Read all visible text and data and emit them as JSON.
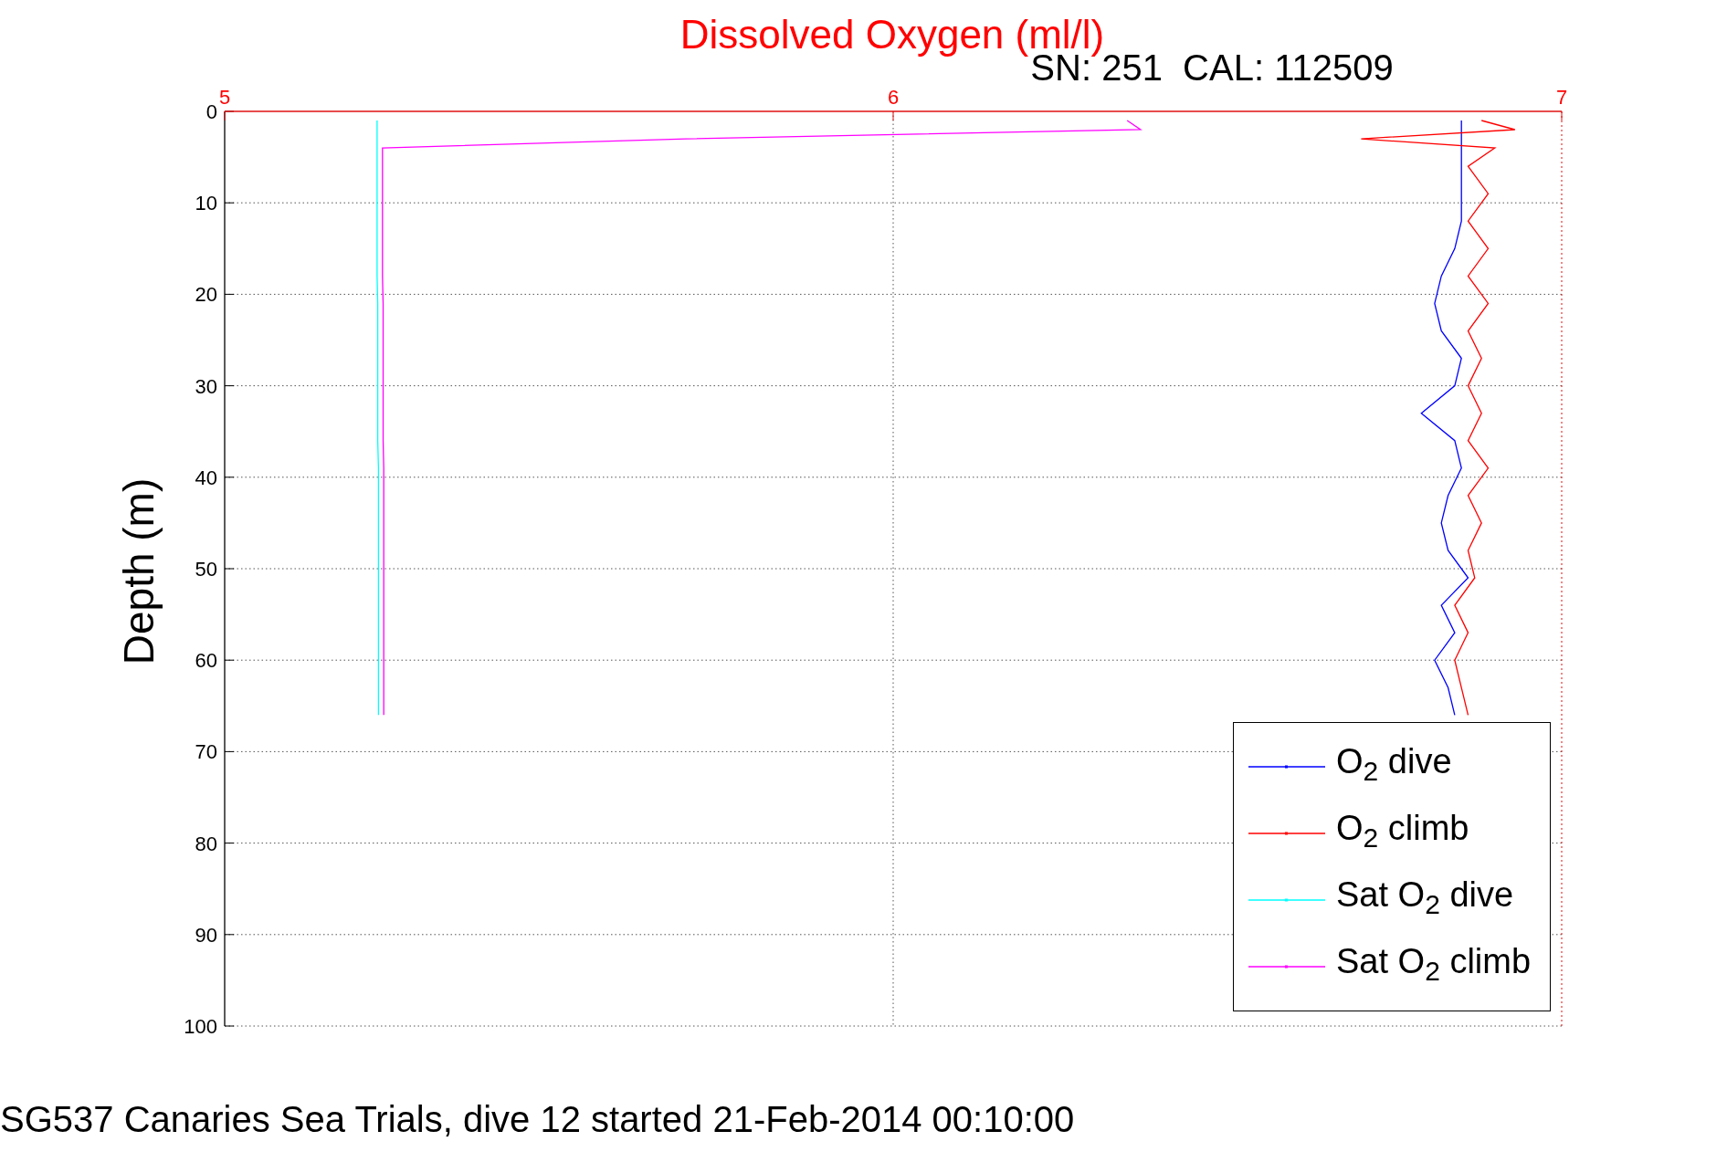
{
  "chart": {
    "chart_data": {
      "type": "line",
      "title": "Dissolved Oxygen (ml/l)",
      "ylabel": "Depth (m)",
      "orientation": "horizontal",
      "grid": true,
      "xlim": [
        5,
        7
      ],
      "xticks": [
        5,
        6,
        7
      ],
      "ylim": [
        100,
        0
      ],
      "yticks": [
        0,
        10,
        20,
        30,
        40,
        50,
        60,
        70,
        80,
        90,
        100
      ],
      "x": [
        1,
        2,
        3,
        4,
        6,
        9,
        12,
        15,
        18,
        21,
        24,
        27,
        30,
        33,
        36,
        39,
        42,
        45,
        48,
        51,
        54,
        57,
        60,
        63,
        66
      ],
      "series": [
        {
          "name": "O$_{2}$ dive",
          "color": "#0000ff",
          "values": [
            6.85,
            6.85,
            6.85,
            6.85,
            6.85,
            6.85,
            6.85,
            6.84,
            6.82,
            6.81,
            6.82,
            6.85,
            6.84,
            6.79,
            6.84,
            6.85,
            6.83,
            6.82,
            6.83,
            6.86,
            6.82,
            6.84,
            6.81,
            6.83,
            6.84
          ]
        },
        {
          "name": "O$_{2}$ climb",
          "color": "#ff0000",
          "values": [
            6.88,
            6.93,
            6.7,
            6.9,
            6.86,
            6.89,
            6.86,
            6.89,
            6.86,
            6.89,
            6.86,
            6.88,
            6.86,
            6.88,
            6.86,
            6.89,
            6.86,
            6.88,
            6.86,
            6.87,
            6.84,
            6.86,
            6.84,
            6.85,
            6.86
          ]
        },
        {
          "name": "Sat O$_{2}$ dive",
          "color": "#00ffff",
          "values": [
            5.228,
            5.228,
            5.228,
            5.228,
            5.228,
            5.228,
            5.228,
            5.228,
            5.228,
            5.229,
            5.229,
            5.229,
            5.229,
            5.229,
            5.229,
            5.23,
            5.23,
            5.23,
            5.23,
            5.23,
            5.23,
            5.23,
            5.23,
            5.23,
            5.23
          ]
        },
        {
          "name": "Sat O$_{2}$ climb",
          "color": "#ff00ff",
          "values": [
            6.35,
            6.37,
            5.69,
            5.236,
            5.236,
            5.236,
            5.236,
            5.236,
            5.236,
            5.237,
            5.237,
            5.237,
            5.237,
            5.237,
            5.237,
            5.238,
            5.238,
            5.238,
            5.238,
            5.238,
            5.238,
            5.238,
            5.238,
            5.238,
            5.238
          ]
        }
      ]
    },
    "subtitle": "SN: 251  CAL: 112509"
  },
  "caption": "SG537 Canaries Sea Trials, dive 12 started 21-Feb-2014 00:10:00"
}
